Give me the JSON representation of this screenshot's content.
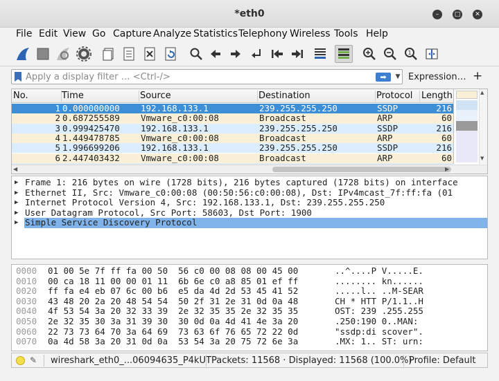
{
  "window": {
    "title": "*eth0"
  },
  "menu": [
    "File",
    "Edit",
    "View",
    "Go",
    "Capture",
    "Analyze",
    "Statistics",
    "Telephony",
    "Wireless",
    "Tools",
    "Help"
  ],
  "filter": {
    "placeholder": "Apply a display filter … <Ctrl-/>",
    "expression_label": "Expression…",
    "plus_label": "+"
  },
  "packet_list": {
    "columns": [
      "No.",
      "Time",
      "Source",
      "Destination",
      "Protocol",
      "Length"
    ],
    "rows": [
      {
        "no": "1",
        "time": "0.000000000",
        "source": "192.168.133.1",
        "destination": "239.255.255.250",
        "protocol": "SSDP",
        "length": "216"
      },
      {
        "no": "2",
        "time": "0.687255589",
        "source": "Vmware_c0:00:08",
        "destination": "Broadcast",
        "protocol": "ARP",
        "length": "60"
      },
      {
        "no": "3",
        "time": "0.999425470",
        "source": "192.168.133.1",
        "destination": "239.255.255.250",
        "protocol": "SSDP",
        "length": "216"
      },
      {
        "no": "4",
        "time": "1.449478785",
        "source": "Vmware_c0:00:08",
        "destination": "Broadcast",
        "protocol": "ARP",
        "length": "60"
      },
      {
        "no": "5",
        "time": "1.996699206",
        "source": "192.168.133.1",
        "destination": "239.255.255.250",
        "protocol": "SSDP",
        "length": "216"
      },
      {
        "no": "6",
        "time": "2.447403432",
        "source": "Vmware_c0:00:08",
        "destination": "Broadcast",
        "protocol": "ARP",
        "length": "60"
      }
    ],
    "colors": {
      "selected": "#3c8fd6",
      "ssdp": "#daeeff",
      "arp": "#faf0d7"
    }
  },
  "details": [
    "Frame 1: 216 bytes on wire (1728 bits), 216 bytes captured (1728 bits) on interface",
    "Ethernet II, Src: Vmware_c0:00:08 (00:50:56:c0:00:08), Dst: IPv4mcast_7f:ff:fa (01",
    "Internet Protocol Version 4, Src: 192.168.133.1, Dst: 239.255.255.250",
    "User Datagram Protocol, Src Port: 58603, Dst Port: 1900",
    "Simple Service Discovery Protocol"
  ],
  "bytes": [
    {
      "offset": "0000",
      "hex": "01 00 5e 7f ff fa 00 50  56 c0 00 08 08 00 45 00",
      "ascii": "..^....P V.....E."
    },
    {
      "offset": "0010",
      "hex": "00 ca 18 11 00 00 01 11  6b 6e c0 a8 85 01 ef ff",
      "ascii": "........ kn......"
    },
    {
      "offset": "0020",
      "hex": "ff fa e4 eb 07 6c 00 b6  e5 da 4d 2d 53 45 41 52",
      "ascii": ".....l.. ..M-SEAR"
    },
    {
      "offset": "0030",
      "hex": "43 48 20 2a 20 48 54 54  50 2f 31 2e 31 0d 0a 48",
      "ascii": "CH * HTT P/1.1..H"
    },
    {
      "offset": "0040",
      "hex": "4f 53 54 3a 20 32 33 39  2e 32 35 35 2e 32 35 35",
      "ascii": "OST: 239 .255.255"
    },
    {
      "offset": "0050",
      "hex": "2e 32 35 30 3a 31 39 30  30 0d 0a 4d 41 4e 3a 20",
      "ascii": ".250:190 0..MAN: "
    },
    {
      "offset": "0060",
      "hex": "22 73 73 64 70 3a 64 69  73 63 6f 76 65 72 22 0d",
      "ascii": "\"ssdp:di scover\"."
    },
    {
      "offset": "0070",
      "hex": "0a 4d 58 3a 20 31 0d 0a  53 54 3a 20 75 72 6e 3a",
      "ascii": ".MX: 1.. ST: urn:"
    }
  ],
  "status": {
    "file": "wireshark_eth0_...06094635_P4kUT",
    "packets": "Packets: 11568 · Displayed: 11568 (100.0%)",
    "profile": "Profile: Default"
  }
}
